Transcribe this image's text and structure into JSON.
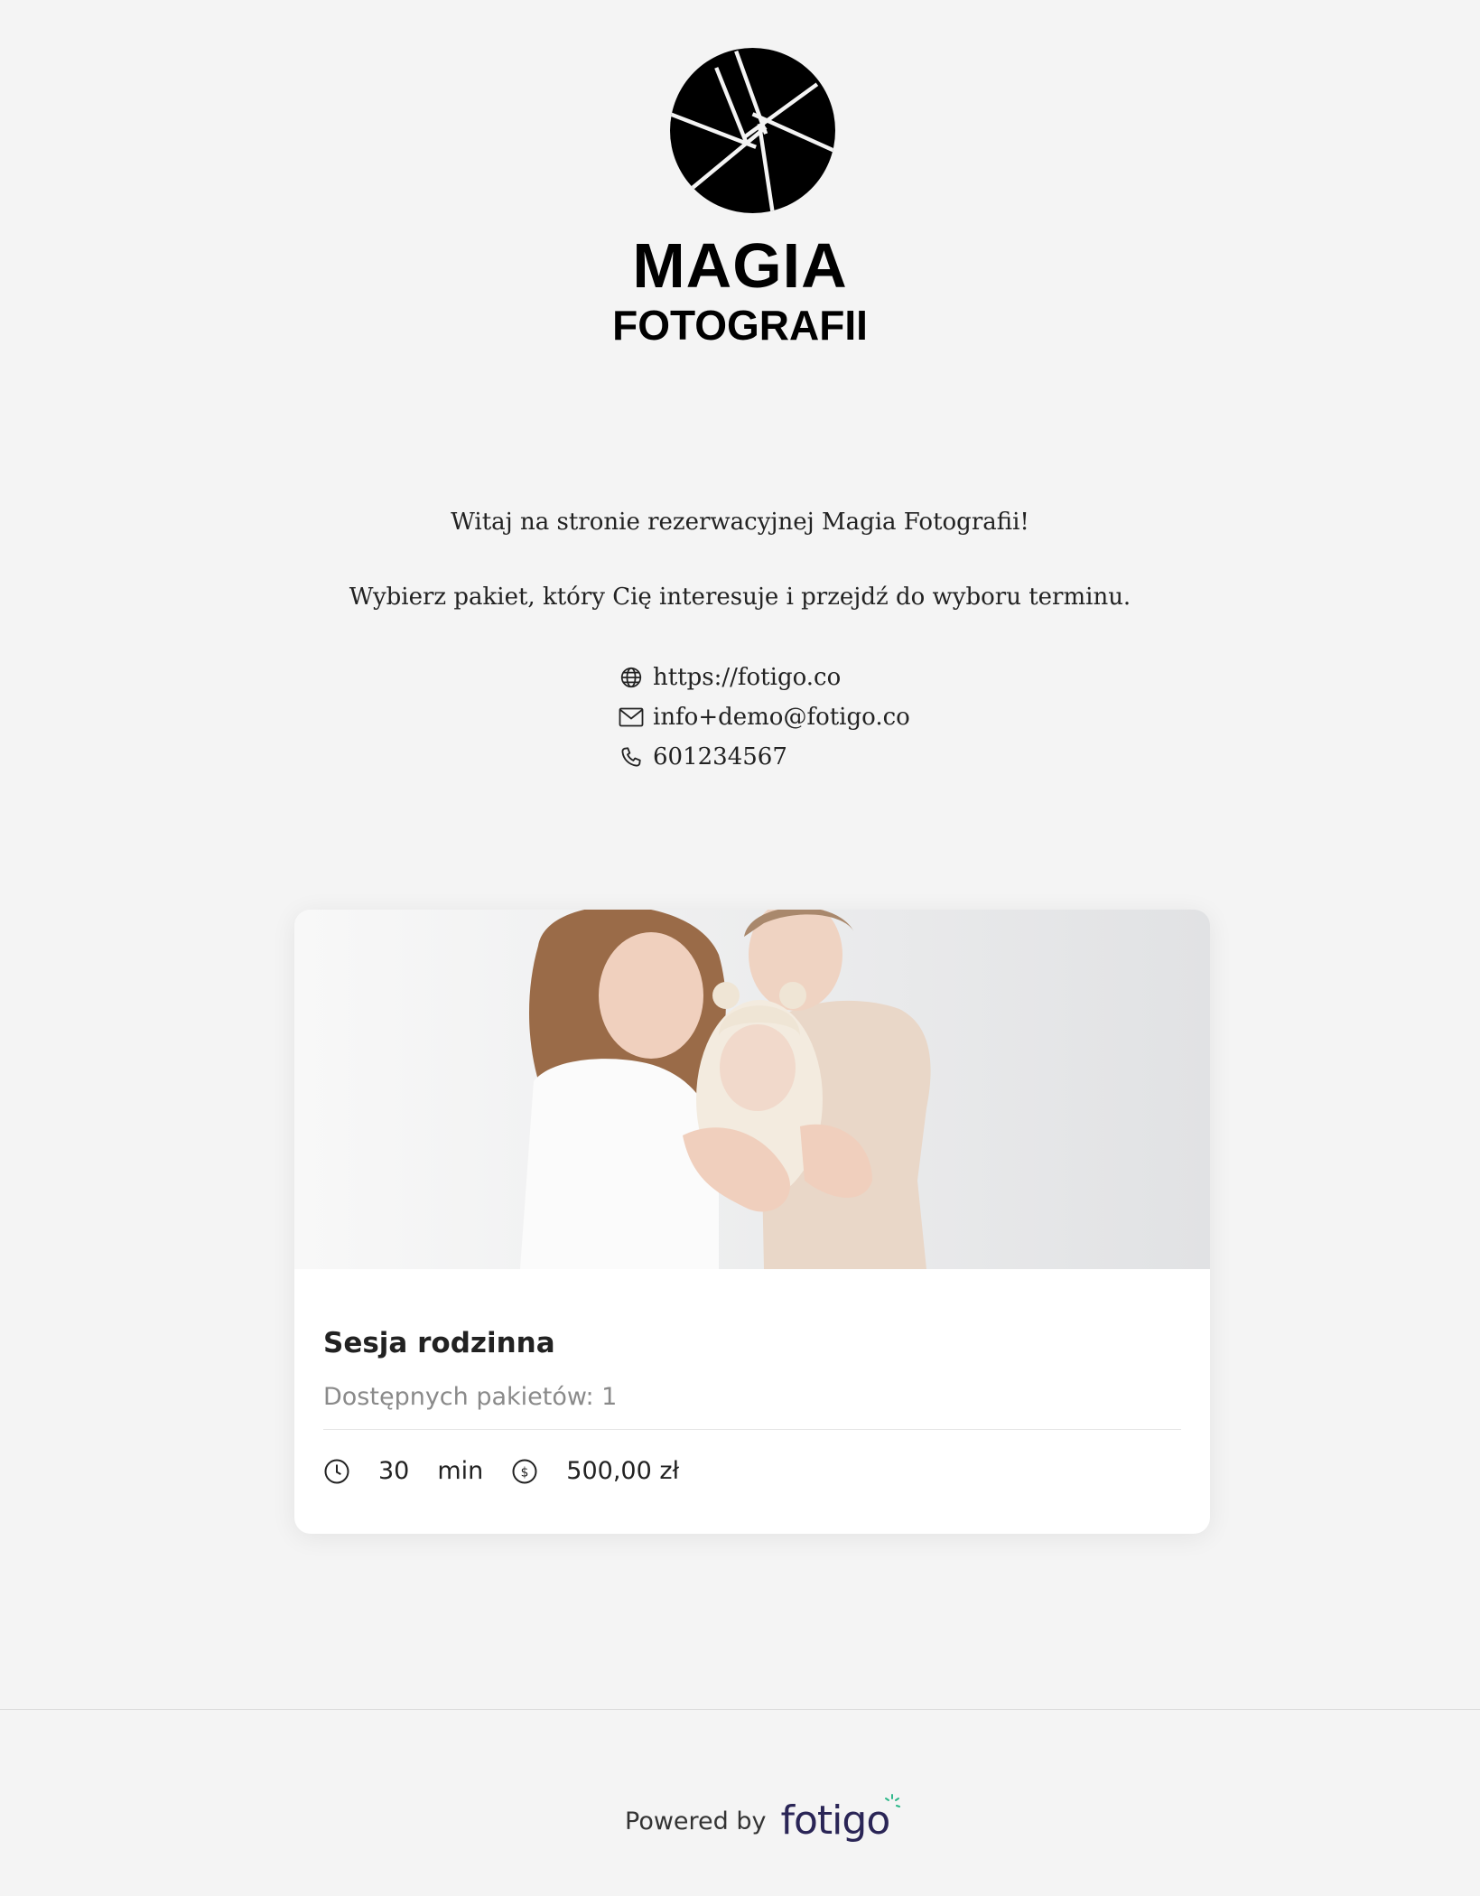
{
  "header": {
    "logo_icon": "camera-aperture-icon",
    "logo_title_main": "MAGIA",
    "logo_title_sub": "FOTOGRAFII"
  },
  "intro": {
    "welcome_line": "Witaj na stronie rezerwacyjnej Magia Fotografii!",
    "instruction_line": "Wybierz pakiet, który Cię interesuje i przejdź do wyboru terminu."
  },
  "contacts": {
    "website": {
      "icon": "globe-icon",
      "value": "https://fotigo.co"
    },
    "email": {
      "icon": "mail-icon",
      "value": "info+demo@fotigo.co"
    },
    "phone": {
      "icon": "phone-icon",
      "value": "601234567"
    }
  },
  "packages": [
    {
      "image": "family-photo",
      "title": "Sesja rodzinna",
      "subtitle": "Dostępnych pakietów: 1",
      "duration_value": "30",
      "duration_unit": "min",
      "price": "500,00 zł",
      "duration_icon": "clock-icon",
      "price_icon": "dollar-coin-icon"
    }
  ],
  "footer": {
    "powered_label": "Powered by",
    "brand": "fotigo",
    "brand_accent_color": "#2fb88a",
    "brand_color": "#2a2556"
  }
}
